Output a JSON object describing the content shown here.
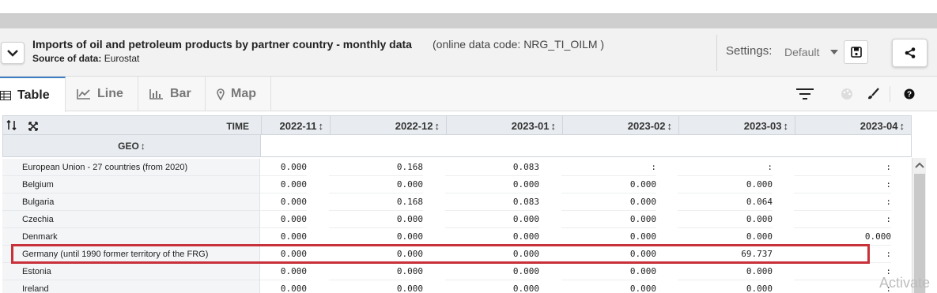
{
  "header": {
    "title": "Imports of oil and petroleum products by partner country - monthly data",
    "online_code": "(online data code: NRG_TI_OILM )",
    "source_label": "Source of data:",
    "source_value": "Eurostat",
    "settings_label": "Settings:",
    "settings_value": "Default"
  },
  "tabs": [
    {
      "label": "Table",
      "icon": "table-icon"
    },
    {
      "label": "Line",
      "icon": "line-chart-icon"
    },
    {
      "label": "Bar",
      "icon": "bar-chart-icon"
    },
    {
      "label": "Map",
      "icon": "map-pin-icon"
    }
  ],
  "table": {
    "time_label": "TIME",
    "geo_label": "GEO",
    "columns": [
      "2022-11",
      "2022-12",
      "2023-01",
      "2023-02",
      "2023-03",
      "2023-04"
    ],
    "rows": [
      {
        "geo": "European Union - 27 countries (from 2020)",
        "values": [
          "0.000",
          "0.168",
          "0.083",
          ":",
          ":",
          ":"
        ]
      },
      {
        "geo": "Belgium",
        "values": [
          "0.000",
          "0.000",
          "0.000",
          "0.000",
          "0.000",
          ":"
        ]
      },
      {
        "geo": "Bulgaria",
        "values": [
          "0.000",
          "0.168",
          "0.083",
          "0.000",
          "0.064",
          ":"
        ]
      },
      {
        "geo": "Czechia",
        "values": [
          "0.000",
          "0.000",
          "0.000",
          "0.000",
          "0.000",
          ":"
        ]
      },
      {
        "geo": "Denmark",
        "values": [
          "0.000",
          "0.000",
          "0.000",
          "0.000",
          "0.000",
          "0.000"
        ]
      },
      {
        "geo": "Germany (until 1990 former territory of the FRG)",
        "values": [
          "0.000",
          "0.000",
          "0.000",
          "0.000",
          "69.737",
          ":"
        ]
      },
      {
        "geo": "Estonia",
        "values": [
          "0.000",
          "0.000",
          "0.000",
          "0.000",
          "0.000",
          ":"
        ]
      },
      {
        "geo": "Ireland",
        "values": [
          "0.000",
          "0.000",
          "0.000",
          "0.000",
          "0.000",
          ":"
        ]
      }
    ]
  },
  "watermark": "Activate",
  "colors": {
    "highlight": "#c8303a",
    "active_tab_accent": "#3a7fc1"
  }
}
